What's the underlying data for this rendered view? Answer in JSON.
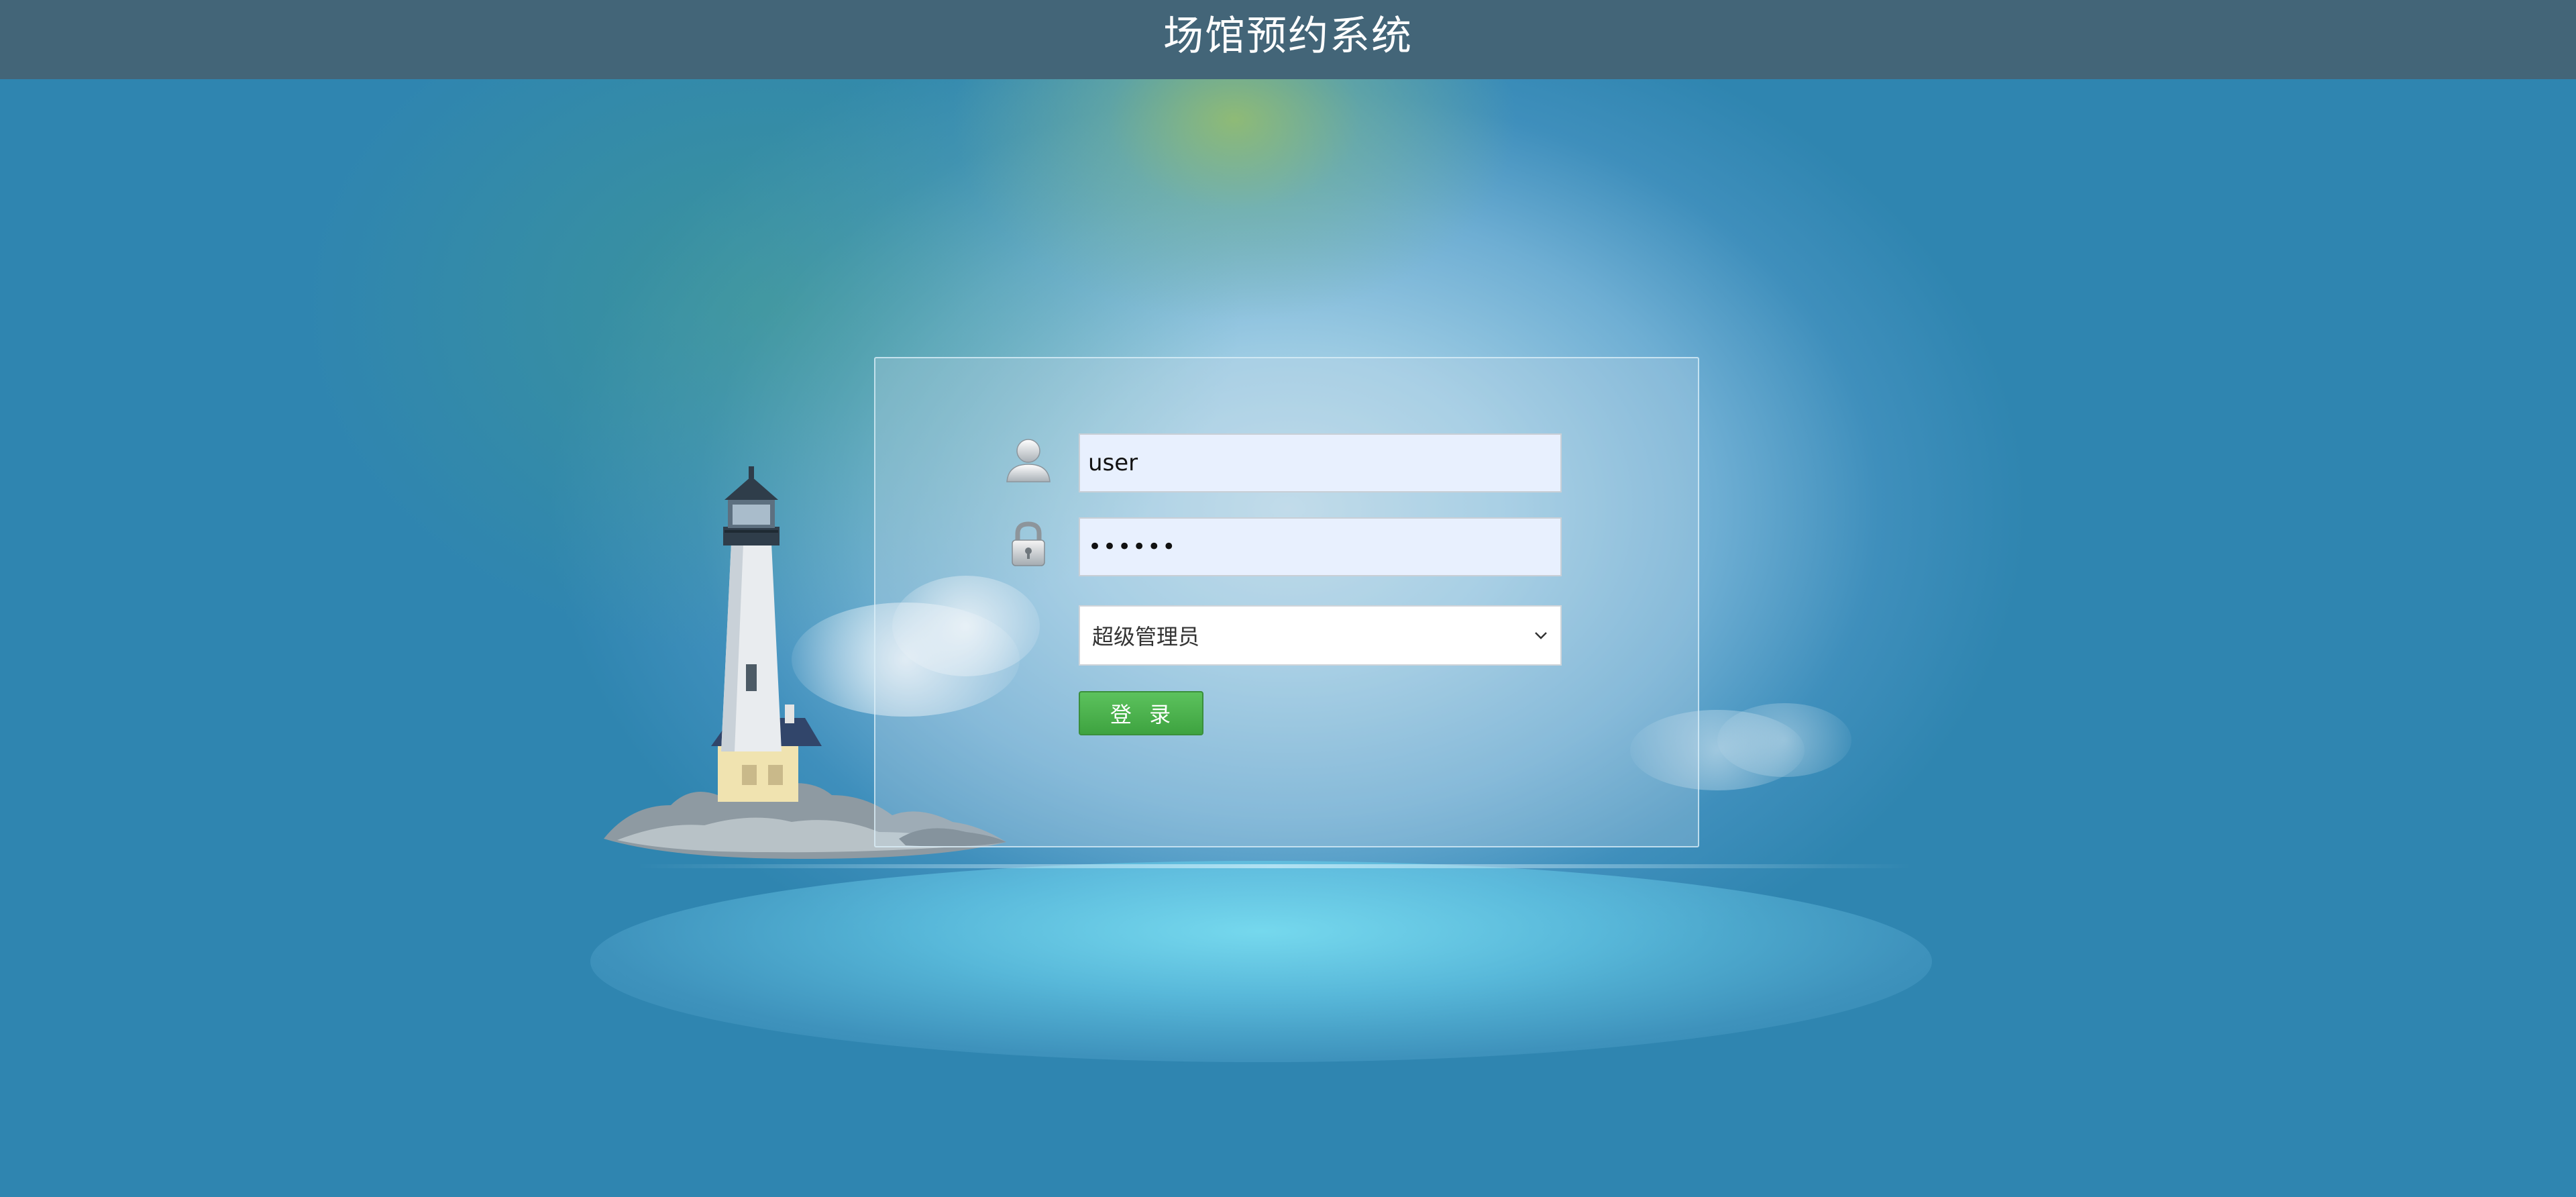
{
  "header": {
    "title": "场馆预约系统"
  },
  "login": {
    "username_value": "user",
    "password_value": "••••••",
    "role_select": {
      "selected": "超级管理员"
    },
    "submit_label": "登  录"
  },
  "icons": {
    "user": "user-icon",
    "lock": "lock-icon",
    "dropdown": "chevron-down-icon"
  },
  "colors": {
    "header_bg": "#436578",
    "page_bg": "#2f85b0",
    "button_green": "#4cb34d",
    "field_bg": "#e8f0fe"
  }
}
